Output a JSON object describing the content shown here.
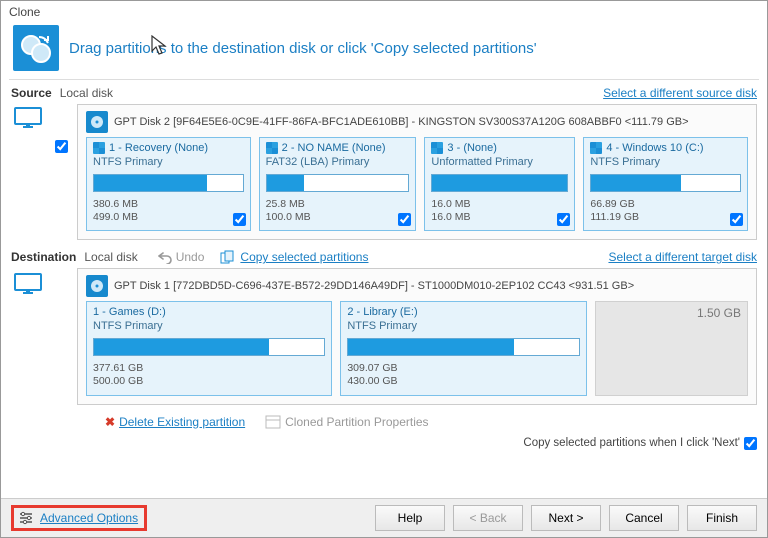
{
  "title": "Clone",
  "header_text": "Drag partitions to the destination disk or click 'Copy selected partitions'",
  "source": {
    "label": "Source",
    "sub": "Local disk",
    "link": "Select a different source disk",
    "disk_head": "GPT Disk 2 [9F64E5E6-0C9E-41FF-86FA-BFC1ADE610BB] - KINGSTON SV300S37A120G 608ABBF0  <111.79 GB>",
    "partitions": [
      {
        "title": "1 - Recovery (None)",
        "fs": "NTFS Primary",
        "used": "380.6 MB",
        "total": "499.0 MB",
        "fill": 76,
        "win": true
      },
      {
        "title": "2 - NO NAME (None)",
        "fs": "FAT32 (LBA) Primary",
        "used": "25.8 MB",
        "total": "100.0 MB",
        "fill": 26,
        "win": true
      },
      {
        "title": "3 -  (None)",
        "fs": "Unformatted Primary",
        "used": "16.0 MB",
        "total": "16.0 MB",
        "fill": 100,
        "win": true
      },
      {
        "title": "4 - Windows 10 (C:)",
        "fs": "NTFS Primary",
        "used": "66.89 GB",
        "total": "111.19 GB",
        "fill": 60,
        "win": true
      }
    ]
  },
  "destination": {
    "label": "Destination",
    "sub": "Local disk",
    "undo": "Undo",
    "copy": "Copy selected partitions",
    "link": "Select a different target disk",
    "disk_head": "GPT Disk 1 [772DBD5D-C696-437E-B572-29DD146A49DF] - ST1000DM010-2EP102 CC43  <931.51 GB>",
    "partitions": [
      {
        "title": "1 - Games (D:)",
        "fs": "NTFS Primary",
        "used": "377.61 GB",
        "total": "500.00 GB",
        "fill": 76
      },
      {
        "title": "2 - Library (E:)",
        "fs": "NTFS Primary",
        "used": "309.07 GB",
        "total": "430.00 GB",
        "fill": 72
      }
    ],
    "free_label": "1.50 GB"
  },
  "actions": {
    "delete": "Delete Existing partition",
    "cloned_props": "Cloned Partition Properties",
    "next_note": "Copy selected partitions when I click 'Next'"
  },
  "footer": {
    "advanced": "Advanced Options",
    "help": "Help",
    "back": "< Back",
    "next": "Next >",
    "cancel": "Cancel",
    "finish": "Finish"
  }
}
